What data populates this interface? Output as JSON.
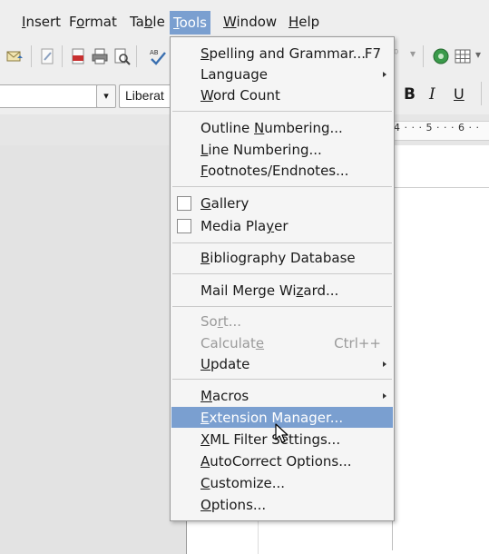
{
  "menubar": {
    "items": [
      {
        "pre": "",
        "key": "I",
        "post": "nsert"
      },
      {
        "pre": "F",
        "key": "o",
        "post": "rmat"
      },
      {
        "pre": "Ta",
        "key": "b",
        "post": "le"
      },
      {
        "pre": "",
        "key": "T",
        "post": "ools"
      },
      {
        "pre": "",
        "key": "W",
        "post": "indow"
      },
      {
        "pre": "",
        "key": "H",
        "post": "elp"
      }
    ]
  },
  "toolbar": {
    "font_name": "Liberat",
    "bold": "B",
    "italic": "I",
    "underline": "U"
  },
  "ruler": {
    "text": "4 · · · 5 · · · 6 · ·"
  },
  "tools_menu": {
    "spelling": {
      "pre": "",
      "key": "S",
      "post": "pelling and Grammar...",
      "shortcut": "F7"
    },
    "language": {
      "label": "Language"
    },
    "word_count": {
      "pre": "",
      "key": "W",
      "post": "ord Count"
    },
    "outline_numbering": {
      "pre": "Outline ",
      "key": "N",
      "post": "umbering..."
    },
    "line_numbering": {
      "pre": "",
      "key": "L",
      "post": "ine Numbering..."
    },
    "footnotes": {
      "pre": "",
      "key": "F",
      "post": "ootnotes/Endnotes..."
    },
    "gallery": {
      "pre": "",
      "key": "G",
      "post": "allery"
    },
    "media_player": {
      "pre": "Media Pla",
      "key": "y",
      "post": "er"
    },
    "bibliography": {
      "pre": "",
      "key": "B",
      "post": "ibliography Database"
    },
    "mail_merge": {
      "pre": "Mail Merge Wi",
      "key": "z",
      "post": "ard..."
    },
    "sort": {
      "pre": "So",
      "key": "r",
      "post": "t..."
    },
    "calculate": {
      "pre": "Calculat",
      "key": "e",
      "post": "",
      "shortcut": "Ctrl++"
    },
    "update": {
      "pre": "",
      "key": "U",
      "post": "pdate"
    },
    "macros": {
      "pre": "",
      "key": "M",
      "post": "acros"
    },
    "extension_manager": {
      "pre": "",
      "key": "E",
      "post": "xtension Manager..."
    },
    "xml_filter": {
      "pre": "",
      "key": "X",
      "post": "ML Filter Settings..."
    },
    "autocorrect": {
      "pre": "",
      "key": "A",
      "post": "utoCorrect Options..."
    },
    "customize": {
      "pre": "",
      "key": "C",
      "post": "ustomize..."
    },
    "options": {
      "pre": "",
      "key": "O",
      "post": "ptions..."
    }
  },
  "colors": {
    "highlight": "#7a9fd0",
    "disabled_text": "#9a9a9a"
  }
}
